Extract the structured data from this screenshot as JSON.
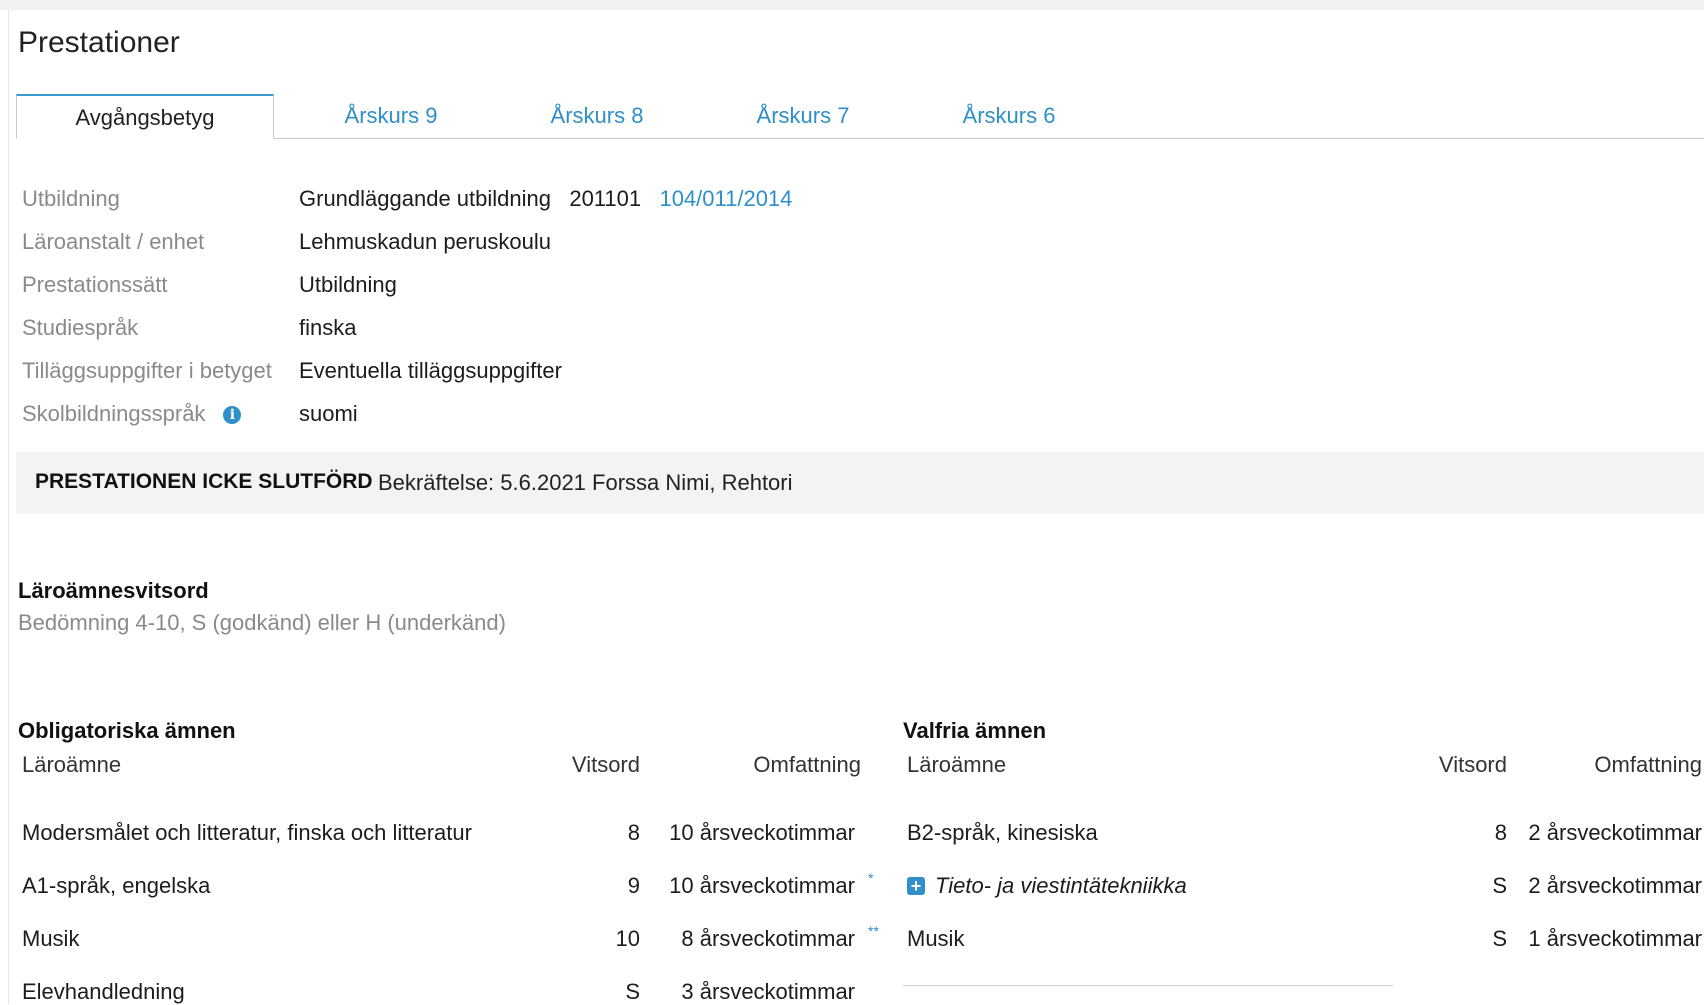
{
  "page": {
    "title": "Prestationer"
  },
  "tabs": [
    {
      "label": "Avgångsbetyg",
      "active": true
    },
    {
      "label": "Årskurs 9"
    },
    {
      "label": "Årskurs 8"
    },
    {
      "label": "Årskurs 7"
    },
    {
      "label": "Årskurs 6"
    }
  ],
  "info": {
    "utbildning": {
      "label": "Utbildning",
      "value": "Grundläggande utbildning",
      "code": "201101",
      "link": "104/011/2014"
    },
    "laroanstalt": {
      "label": "Läroanstalt / enhet",
      "value": "Lehmuskadun peruskoulu"
    },
    "prestationssatt": {
      "label": "Prestationssätt",
      "value": "Utbildning"
    },
    "studiesprak": {
      "label": "Studiespråk",
      "value": "finska"
    },
    "tillagg": {
      "label": "Tilläggsuppgifter i betyget",
      "value": "Eventuella tilläggsuppgifter"
    },
    "skolbildning": {
      "label": "Skolbildningsspråk",
      "icon": "info-icon",
      "icon_glyph": "i",
      "value": "suomi"
    }
  },
  "status": {
    "state": "PRESTATIONEN ICKE SLUTFÖRD",
    "text": "Bekräftelse: 5.6.2021 Forssa    Nimi, Rehtori"
  },
  "grades": {
    "title": "Läroämnesvitsord",
    "subtitle": "Bedömning 4-10, S (godkänd) eller H (underkänd)"
  },
  "mandatory": {
    "title": "Obligatoriska ämnen",
    "headers": {
      "subject": "Läroämne",
      "grade": "Vitsord",
      "scope": "Omfattning"
    },
    "rows": [
      {
        "subject": "Modersmålet och litteratur, finska och litteratur",
        "grade": "8",
        "scope": "10 årsveckotimmar",
        "mark": ""
      },
      {
        "subject": "A1-språk, engelska",
        "grade": "9",
        "scope": "10 årsveckotimmar",
        "mark": "*"
      },
      {
        "subject": "Musik",
        "grade": "10",
        "scope": "8 årsveckotimmar",
        "mark": "**"
      },
      {
        "subject": "Elevhandledning",
        "grade": "S",
        "scope": "3 årsveckotimmar",
        "mark": ""
      }
    ]
  },
  "optional": {
    "title": "Valfria ämnen",
    "headers": {
      "subject": "Läroämne",
      "grade": "Vitsord",
      "scope": "Omfattning"
    },
    "rows": [
      {
        "subject": "B2-språk, kinesiska",
        "grade": "8",
        "scope": "2 årsveckotimmar"
      },
      {
        "subject": "Tieto- ja viestintätekniikka",
        "grade": "S",
        "scope": "2 årsveckotimmar",
        "icon": "plus-icon",
        "icon_glyph": "+"
      },
      {
        "subject": "Musik",
        "grade": "S",
        "scope": "1 årsveckotimmar"
      }
    ]
  }
}
